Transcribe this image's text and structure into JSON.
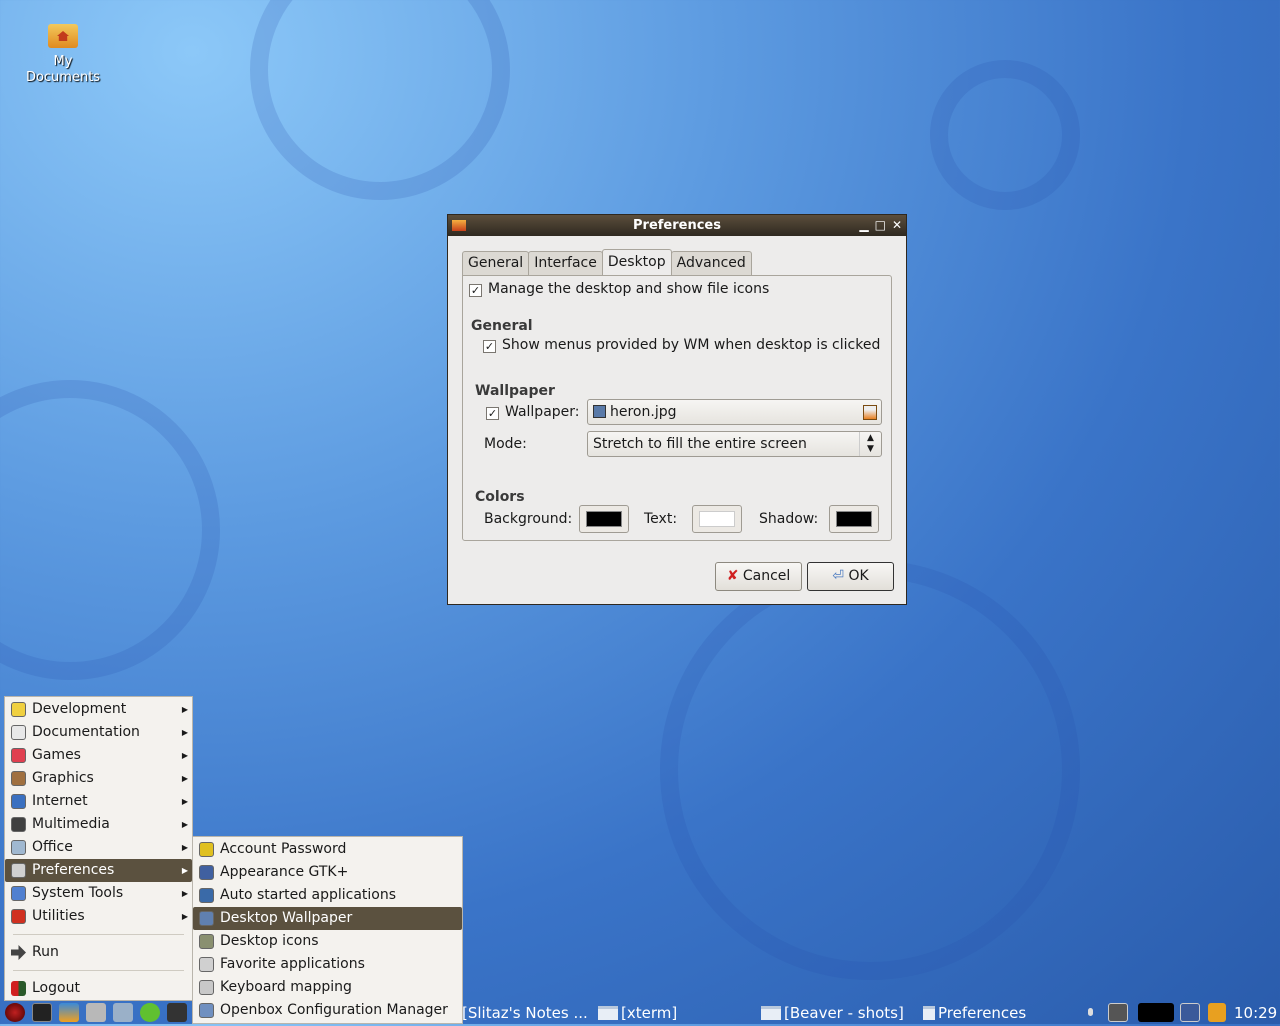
{
  "desktop": {
    "icon_label": "My Documents"
  },
  "dialog": {
    "title": "Preferences",
    "tabs": [
      {
        "label": "General"
      },
      {
        "label": "Interface"
      },
      {
        "label": "Desktop",
        "active": true
      },
      {
        "label": "Advanced"
      }
    ],
    "manage_desktop": {
      "label": "Manage the desktop and show file icons",
      "checked": true
    },
    "general_header": "General",
    "show_wm_menus": {
      "label": "Show menus provided by WM when desktop is clicked",
      "checked": true
    },
    "wallpaper_header": "Wallpaper",
    "wallpaper": {
      "label": "Wallpaper:",
      "checked": true,
      "file": "heron.jpg"
    },
    "mode": {
      "label": "Mode:",
      "value": "Stretch to fill the entire screen"
    },
    "colors_header": "Colors",
    "colors": {
      "background_label": "Background:",
      "background": "#000000",
      "text_label": "Text:",
      "text": "#ffffff",
      "shadow_label": "Shadow:",
      "shadow": "#000000"
    },
    "cancel_label": "Cancel",
    "ok_label": "OK"
  },
  "menu": {
    "items": [
      {
        "label": "Development",
        "icon": "development-icon",
        "color": "#f0d040"
      },
      {
        "label": "Documentation",
        "icon": "documentation-icon",
        "color": "#e8e8e8"
      },
      {
        "label": "Games",
        "icon": "games-icon",
        "color": "#e04050"
      },
      {
        "label": "Graphics",
        "icon": "graphics-icon",
        "color": "#a07040"
      },
      {
        "label": "Internet",
        "icon": "internet-icon",
        "color": "#3a70c0"
      },
      {
        "label": "Multimedia",
        "icon": "multimedia-icon",
        "color": "#404040"
      },
      {
        "label": "Office",
        "icon": "office-icon",
        "color": "#a0b8d0"
      },
      {
        "label": "Preferences",
        "icon": "preferences-icon",
        "color": "#d0d0d0"
      },
      {
        "label": "System Tools",
        "icon": "system-tools-icon",
        "color": "#5080d0"
      },
      {
        "label": "Utilities",
        "icon": "utilities-icon",
        "color": "#d03020"
      }
    ],
    "run_label": "Run",
    "logout_label": "Logout"
  },
  "submenu": {
    "items": [
      {
        "label": "Account Password",
        "icon": "lock-icon",
        "color": "#e0c020"
      },
      {
        "label": "Appearance GTK+",
        "icon": "appearance-icon",
        "color": "#4060a0"
      },
      {
        "label": "Auto started applications",
        "icon": "autostart-icon",
        "color": "#3a6aa8"
      },
      {
        "label": "Desktop Wallpaper",
        "icon": "wallpaper-icon",
        "color": "#6080b0"
      },
      {
        "label": "Desktop icons",
        "icon": "desktop-icons-icon",
        "color": "#8a9070"
      },
      {
        "label": "Favorite applications",
        "icon": "favorites-icon",
        "color": "#d0d0d0"
      },
      {
        "label": "Keyboard mapping",
        "icon": "keyboard-icon",
        "color": "#c8c8c8"
      },
      {
        "label": "Openbox Configuration Manager",
        "icon": "openbox-icon",
        "color": "#7090c0"
      }
    ]
  },
  "taskbar": {
    "tasks": [
      {
        "label": "[Slitaz's Notes ..."
      },
      {
        "label": "[xterm]"
      },
      {
        "label": "[Beaver - shots]"
      },
      {
        "label": "Preferences"
      }
    ],
    "clock": "10:29"
  }
}
